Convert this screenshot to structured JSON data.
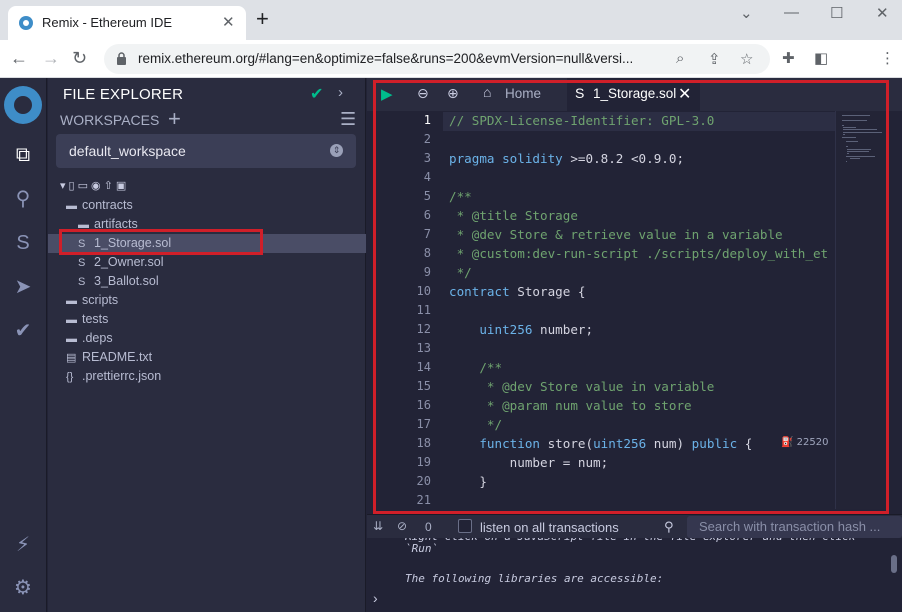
{
  "browser": {
    "tab_title": "Remix - Ethereum IDE",
    "tab_close": "✕",
    "new_tab": "+",
    "url": "remix.ethereum.org/#lang=en&optimize=false&runs=200&evmVersion=null&versi...",
    "win_minimize": "⌄",
    "win_restore": "—",
    "win_max": "☐",
    "win_close": "✕"
  },
  "sidebar": {
    "title": "FILE EXPLORER",
    "workspaces_label": "WORKSPACES",
    "workspace_name": "default_workspace",
    "tree": [
      {
        "label": "contracts",
        "icon": "folder-open-icon",
        "glyph": "▬"
      },
      {
        "label": "artifacts",
        "icon": "folder-icon",
        "glyph": "▬"
      },
      {
        "label": "1_Storage.sol",
        "icon": "solidity-file-icon",
        "glyph": "S",
        "selected": true
      },
      {
        "label": "2_Owner.sol",
        "icon": "solidity-file-icon",
        "glyph": "S"
      },
      {
        "label": "3_Ballot.sol",
        "icon": "solidity-file-icon",
        "glyph": "S"
      },
      {
        "label": "scripts",
        "icon": "folder-icon",
        "glyph": "▬"
      },
      {
        "label": "tests",
        "icon": "folder-icon",
        "glyph": "▬"
      },
      {
        "label": ".deps",
        "icon": "folder-icon",
        "glyph": "▬"
      },
      {
        "label": "README.txt",
        "icon": "text-file-icon",
        "glyph": "▤"
      },
      {
        "label": ".prettierrc.json",
        "icon": "json-file-icon",
        "glyph": "{}"
      }
    ]
  },
  "editor": {
    "home_tab": "Home",
    "file_tab": "1_Storage.sol",
    "gas_estimate": "22520",
    "lines": [
      {
        "n": "1",
        "html": "<span class='cm'>// SPDX-License-Identifier: GPL-3.0</span>"
      },
      {
        "n": "2",
        "html": ""
      },
      {
        "n": "3",
        "html": "<span class='kw'>pragma solidity</span> &gt;=0.8.2 &lt;0.9.0;"
      },
      {
        "n": "4",
        "html": ""
      },
      {
        "n": "5",
        "html": "<span class='cm'>/**</span>"
      },
      {
        "n": "6",
        "html": "<span class='cm'> * @title Storage</span>"
      },
      {
        "n": "7",
        "html": "<span class='cm'> * @dev Store &amp; retrieve value in a variable</span>"
      },
      {
        "n": "8",
        "html": "<span class='cm'> * @custom:dev-run-script ./scripts/deploy_with_et</span>"
      },
      {
        "n": "9",
        "html": "<span class='cm'> */</span>"
      },
      {
        "n": "10",
        "html": "<span class='kw'>contract</span> Storage {"
      },
      {
        "n": "11",
        "html": ""
      },
      {
        "n": "12",
        "html": "    <span class='ty'>uint256</span> number;"
      },
      {
        "n": "13",
        "html": ""
      },
      {
        "n": "14",
        "html": "    <span class='cm'>/**</span>"
      },
      {
        "n": "15",
        "html": "<span class='cm'>     * @dev Store value in variable</span>"
      },
      {
        "n": "16",
        "html": "<span class='cm'>     * @param num value to store</span>"
      },
      {
        "n": "17",
        "html": "<span class='cm'>     */</span>"
      },
      {
        "n": "18",
        "html": "    <span class='kw'>function</span> store(<span class='ty'>uint256</span> num) <span class='kw'>public</span> {"
      },
      {
        "n": "19",
        "html": "        number = num;"
      },
      {
        "n": "20",
        "html": "    }"
      },
      {
        "n": "21",
        "html": ""
      }
    ]
  },
  "terminal": {
    "count": "0",
    "listen_label": "listen on all transactions",
    "search_placeholder": "Search with transaction hash ...",
    "output": [
      "Right click on a JavaScript file in the file explorer and then click",
      "`Run`",
      "",
      "The following libraries are accessible:"
    ]
  },
  "colors": {
    "accent_red": "#d01f29",
    "check_green": "#00bc8c",
    "run_green": "#00bc8c"
  }
}
